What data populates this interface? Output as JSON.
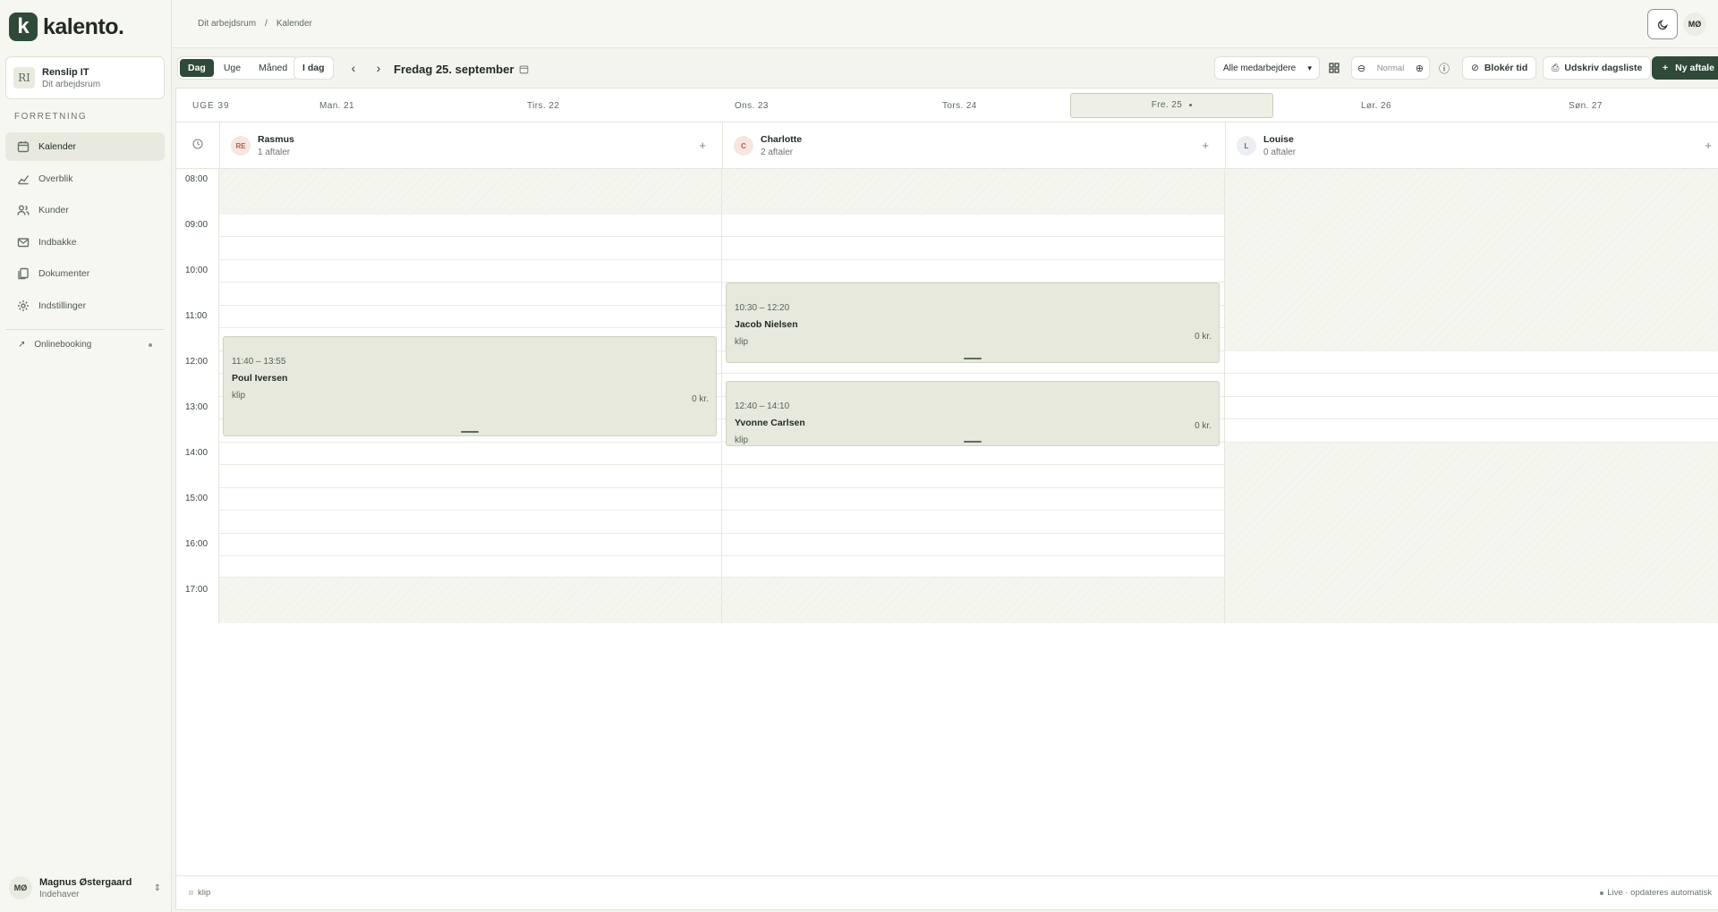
{
  "brand": {
    "mark": "k",
    "name": "kalento",
    "dot": "."
  },
  "workspace": {
    "initials": "RI",
    "name": "Renslip IT",
    "subtitle": "Dit arbejdsrum"
  },
  "sidebar": {
    "section": "FORRETNING",
    "items": [
      {
        "label": "Kalender",
        "icon": "calendar-icon",
        "active": true
      },
      {
        "label": "Overblik",
        "icon": "chart-icon",
        "active": false
      },
      {
        "label": "Kunder",
        "icon": "users-icon",
        "active": false
      },
      {
        "label": "Indbakke",
        "icon": "mail-icon",
        "active": false
      },
      {
        "label": "Dokumenter",
        "icon": "documents-icon",
        "active": false
      },
      {
        "label": "Indstillinger",
        "icon": "gear-icon",
        "active": false
      }
    ],
    "online_booking": "Onlinebooking"
  },
  "user": {
    "initials": "MØ",
    "name": "Magnus Østergaard",
    "role": "Indehaver"
  },
  "header": {
    "breadcrumb": [
      "Dit arbejdsrum",
      "/",
      "Kalender"
    ],
    "avatar": "MØ"
  },
  "toolbar": {
    "views": [
      "Dag",
      "Uge",
      "Måned"
    ],
    "active_view": "Dag",
    "today": "I dag",
    "date_title": "Fredag 25. september",
    "staff_filter": "Alle medarbejdere",
    "zoom_label": "Normal",
    "block_time": "Blokér tid",
    "print": "Udskriv dagsliste",
    "new_appointment": "Ny aftale"
  },
  "week": {
    "label": "UGE 39",
    "days": [
      "Man. 21",
      "Tirs. 22",
      "Ons. 23",
      "Tors. 24",
      "Fre. 25",
      "Lør. 26",
      "Søn. 27"
    ],
    "active_day": "Fre. 25"
  },
  "staff": [
    {
      "initials": "RE",
      "name": "Rasmus",
      "count": "1 aftaler",
      "color": "#f6e6e0",
      "text_color": "#b0604a"
    },
    {
      "initials": "C",
      "name": "Charlotte",
      "count": "2 aftaler",
      "color": "#f6e6e0",
      "text_color": "#b0604a"
    },
    {
      "initials": "L",
      "name": "Louise",
      "count": "0 aftaler",
      "color": "#eceef2",
      "text_color": "#5c6a78"
    }
  ],
  "times": [
    "08:00",
    "09:00",
    "10:00",
    "11:00",
    "12:00",
    "13:00",
    "14:00",
    "15:00",
    "16:00",
    "17:00"
  ],
  "appointments": [
    {
      "time": "11:40 – 13:55",
      "name": "Poul Iversen",
      "service": "klip",
      "price": "0 kr."
    },
    {
      "time": "10:30 – 12:20",
      "name": "Jacob Nielsen",
      "service": "klip",
      "price": "0 kr."
    },
    {
      "time": "12:40 – 14:10",
      "name": "Yvonne Carlsen",
      "service": "klip",
      "price": "0 kr."
    }
  ],
  "footer": {
    "legend": "klip",
    "live": "Live · opdateres automatisk"
  },
  "colors": {
    "accent": "#2f4a37",
    "appointment": "#e6e9dc",
    "background": "#f4f4ee"
  }
}
